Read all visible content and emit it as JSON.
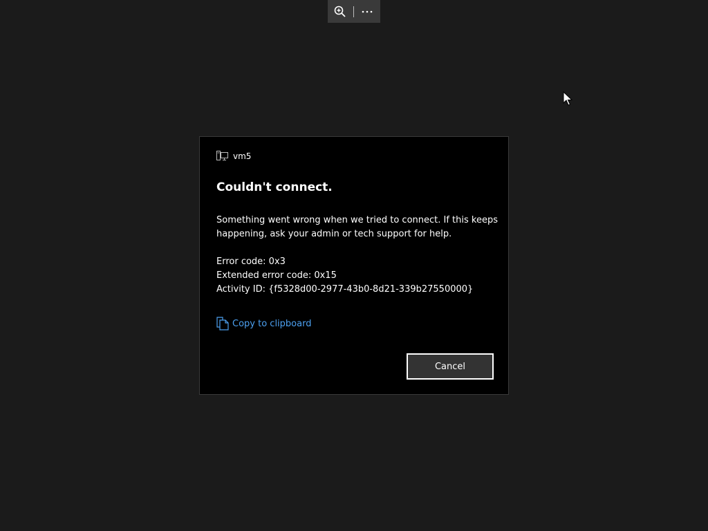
{
  "toolbar": {
    "zoom_icon": "zoom-in-icon",
    "more_icon": "more-options-icon"
  },
  "dialog": {
    "machine_icon": "computer-icon",
    "machine_name": "vm5",
    "title": "Couldn't connect.",
    "message": "Something went wrong when we tried to connect. If this keeps happening, ask your admin or tech support for help.",
    "error_code": "Error code: 0x3",
    "extended_error_code": "Extended error code: 0x15",
    "activity_id": "Activity ID: {f5328d00-2977-43b0-8d21-339b27550000}",
    "copy_icon": "copy-icon",
    "copy_label": "Copy to clipboard",
    "cancel_label": "Cancel"
  },
  "colors": {
    "background": "#1b1b1b",
    "dialog_background": "#000000",
    "link": "#4ca0f0",
    "button_background": "#333333"
  }
}
